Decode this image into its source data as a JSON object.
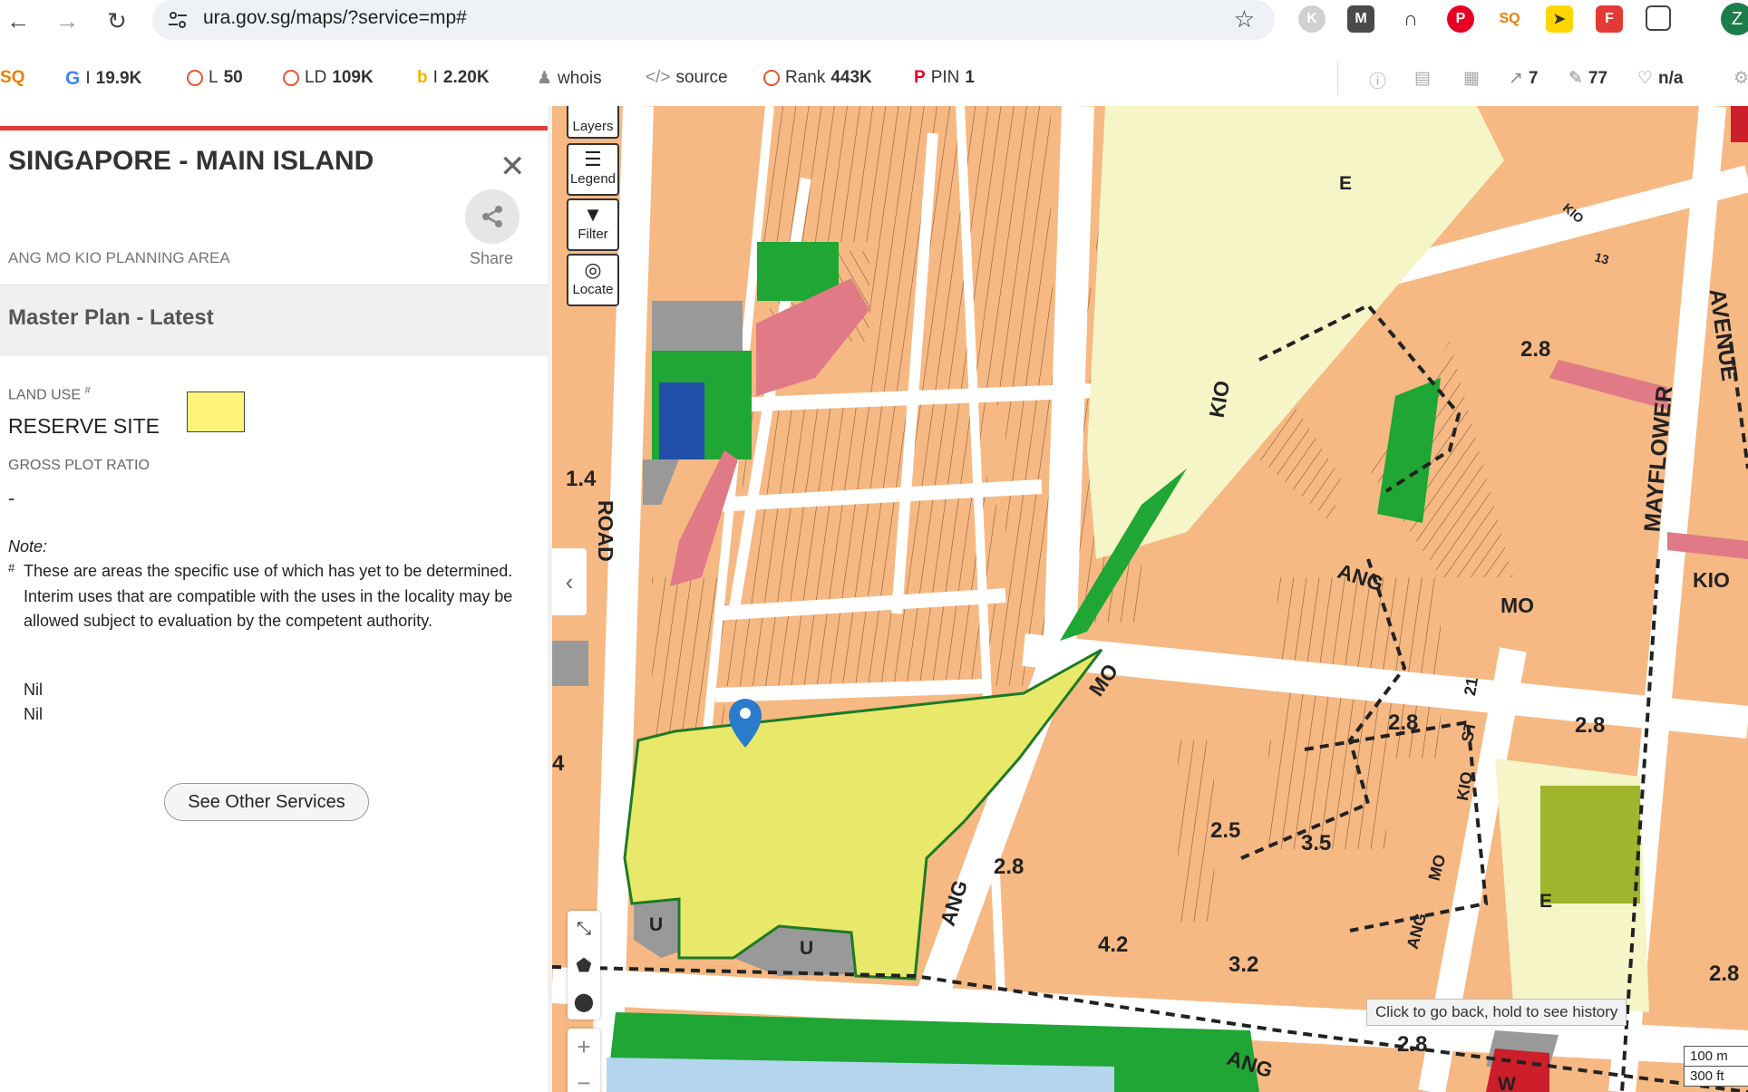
{
  "browser": {
    "url": "ura.gov.sg/maps/?service=mp#",
    "profile_initial": "Z"
  },
  "seo_toolbar": {
    "google": {
      "label": "I",
      "value": "19.9K"
    },
    "l": {
      "label": "L",
      "value": "50"
    },
    "ld": {
      "label": "LD",
      "value": "109K"
    },
    "bing": {
      "label": "I",
      "value": "2.20K"
    },
    "whois": "whois",
    "source": "source",
    "rank": {
      "label": "Rank",
      "value": "443K"
    },
    "pin": {
      "label": "PIN",
      "value": "1"
    },
    "links_ext": "7",
    "links_int": "77",
    "nofollow": "n/a"
  },
  "panel": {
    "title": "SINGAPORE - MAIN ISLAND",
    "planning_area": "ANG MO KIO PLANNING AREA",
    "share_label": "Share",
    "section_title": "Master Plan - Latest",
    "land_use_label": "LAND USE",
    "land_use_sup": "#",
    "land_use_value": "RESERVE SITE",
    "land_use_color": "#fff37a",
    "gpr_label": "GROSS PLOT RATIO",
    "gpr_value": "-",
    "note_label": "Note:",
    "note_hash": "#",
    "note_text": "These are areas the specific use of which has yet to be determined. Interim uses that are compatible with the uses in the locality may be allowed subject to evaluation by the competent authority.",
    "nil_1": "Nil",
    "nil_2": "Nil",
    "other_services_button": "See Other Services"
  },
  "map": {
    "controls": {
      "layers": "Layers",
      "legend": "Legend",
      "filter": "Filter",
      "locate": "Locate"
    },
    "tooltip": "Click to go back, hold to see history",
    "scale_m": "100 m",
    "scale_ft": "300 ft",
    "plot_ratios": [
      "1.4",
      "4",
      "2.8",
      "2.8",
      "2.8",
      "2.8",
      "2.5",
      "3.5",
      "4.2",
      "3.2",
      "2.8",
      "2.8"
    ],
    "zone_labels": [
      "E",
      "E",
      "U",
      "U",
      "W"
    ],
    "roads": {
      "road": "ROAD",
      "kio_1": "KIO",
      "ang_1": "ANG",
      "mo_1": "MO",
      "mo_2": "MO",
      "kio_2": "KIO",
      "ang_2": "ANG",
      "ang_3": "ANG",
      "mayflower": "MAYFLOWER",
      "avenue": "AVENUE",
      "kio_3": "KIO",
      "st_21": "21",
      "st": "ST",
      "kio_st": "KIO",
      "st_13": "13",
      "ang_4": "ANG",
      "mo_4": "MO",
      "kio_4": "KIO"
    },
    "colors": {
      "residential": "#f6b984",
      "reserve": "#e8e86a",
      "park": "#1fa635",
      "education": "#f6f5c7",
      "civic": "#999999",
      "commercial": "#e07a86"
    }
  }
}
